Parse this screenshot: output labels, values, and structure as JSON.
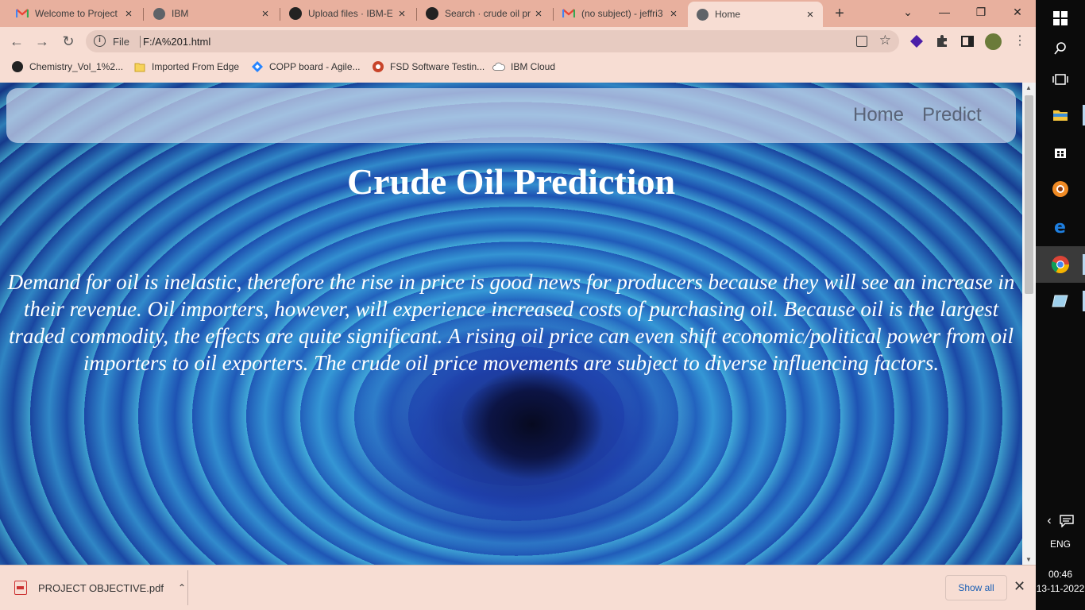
{
  "tabs": [
    {
      "title": "Welcome to Project",
      "icon": "gmail-icon"
    },
    {
      "title": "IBM",
      "icon": "globe-icon"
    },
    {
      "title": "Upload files · IBM-E",
      "icon": "github-icon"
    },
    {
      "title": "Search · crude oil pr",
      "icon": "github-icon"
    },
    {
      "title": "(no subject) - jeffri3",
      "icon": "gmail-icon"
    },
    {
      "title": "Home",
      "icon": "globe-icon",
      "active": true
    }
  ],
  "new_tab_symbol": "+",
  "window_controls": {
    "tab_search": "⌄",
    "minimize": "—",
    "restore": "❐",
    "close": "✕"
  },
  "address_bar": {
    "scheme_label": "File",
    "url": "F:/A%201.html"
  },
  "bookmarks": [
    {
      "label": "Chemistry_Vol_1%2...",
      "icon": "github-icon"
    },
    {
      "label": "Imported From Edge",
      "icon": "folder-icon"
    },
    {
      "label": "COPP board - Agile...",
      "icon": "jira-icon"
    },
    {
      "label": "FSD Software Testin...",
      "icon": "fsd-icon"
    },
    {
      "label": "IBM Cloud",
      "icon": "cloud-icon"
    }
  ],
  "page": {
    "nav": {
      "home": "Home",
      "predict": "Predict"
    },
    "title": "Crude Oil Prediction",
    "description": "Demand for oil is inelastic, therefore the rise in price is good news for producers because they will see an increase in their revenue. Oil importers, however, will experience increased costs of purchasing oil. Because oil is the largest traded commodity, the effects are quite significant. A rising oil price can even shift economic/political power from oil importers to oil exporters. The crude oil price movements are subject to diverse influencing factors."
  },
  "downloads": {
    "item": "PROJECT OBJECTIVE.pdf",
    "show_all": "Show all"
  },
  "taskbar": {
    "language": "ENG",
    "time": "00:46",
    "date": "13-11-2022"
  },
  "colors": {
    "tabstrip": "#e8b09e",
    "toolbar": "#f7ddd3",
    "navbar_bg": "rgba(205,215,235,0.72)",
    "nav_text": "#5a6478",
    "heading": "#ffffff"
  }
}
